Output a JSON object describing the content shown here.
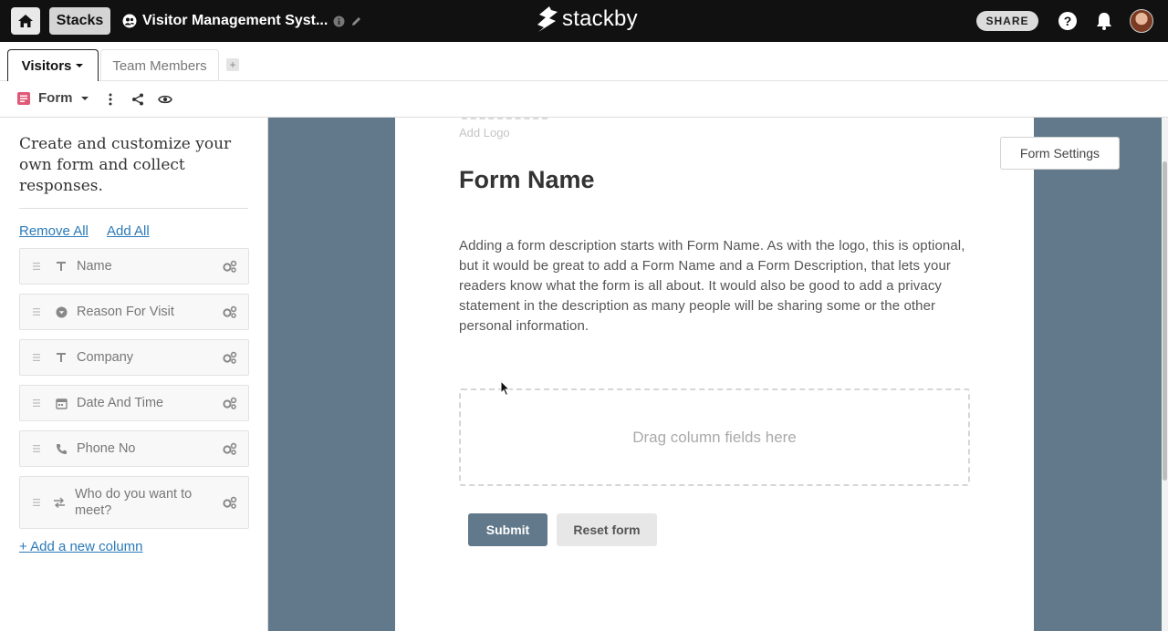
{
  "topbar": {
    "stacks_label": "Stacks",
    "stack_title": "Visitor Management Syst...",
    "brand_name": "stackby",
    "share_label": "SHARE",
    "help_label": "?"
  },
  "tabs": [
    {
      "label": "Visitors",
      "active": true
    },
    {
      "label": "Team Members",
      "active": false
    }
  ],
  "tab_add_label": "+",
  "view": {
    "name": "Form",
    "accent_color": "#e05a78"
  },
  "left_panel": {
    "intro": "Create and customize your own form and collect responses.",
    "remove_all": "Remove All",
    "add_all": "Add All",
    "fields": [
      {
        "label": "Name",
        "icon": "text-type-icon"
      },
      {
        "label": "Reason For Visit",
        "icon": "single-select-icon"
      },
      {
        "label": "Company",
        "icon": "text-type-icon"
      },
      {
        "label": "Date And Time",
        "icon": "calendar-icon"
      },
      {
        "label": "Phone No",
        "icon": "phone-icon"
      },
      {
        "label": "Who do you want to meet?",
        "icon": "link-arrows-icon"
      }
    ],
    "add_column": "+ Add a new column"
  },
  "form": {
    "add_logo": "Add Logo",
    "name": "Form Name",
    "description": "Adding a form description starts with Form Name. As with the logo, this is optional, but it would be great to add a Form Name and a Form Description, that lets your readers know what the form is all about. It would also be good to add a privacy statement in the description as many people will be sharing some or the other personal information.",
    "drop_zone": "Drag column fields here",
    "submit": "Submit",
    "reset": "Reset form",
    "settings": "Form Settings"
  },
  "colors": {
    "topbar_bg": "#111111",
    "main_bg": "#61798a",
    "link": "#2a7ab8"
  }
}
